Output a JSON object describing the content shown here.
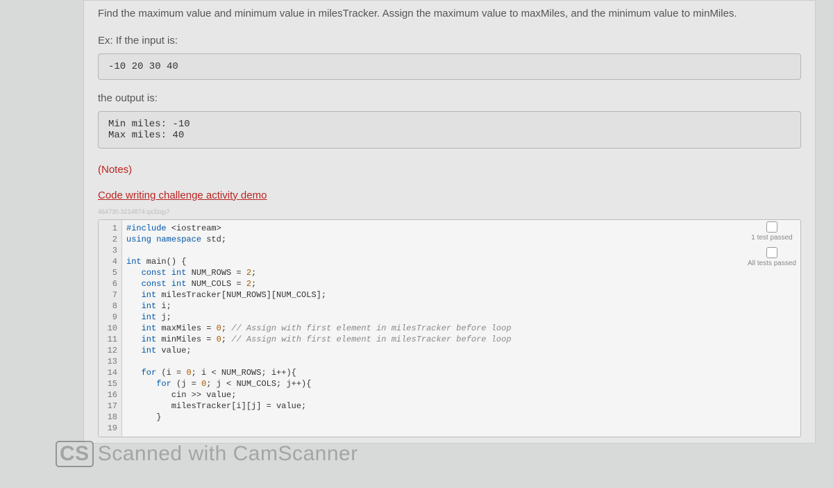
{
  "instruction": "Find the maximum value and minimum value in milesTracker. Assign the maximum value to maxMiles, and the minimum value to minMiles.",
  "exLabel": "Ex: If the input is:",
  "inputCode": "-10 20 30 40",
  "outputLabel": "the output is:",
  "outputCode": "Min miles: -10\nMax miles: 40",
  "notes": "(Notes)",
  "demoLink": "Code writing challenge activity demo",
  "smallId": "464730.3214874.qx3zqy7",
  "gutter": [
    "1",
    "2",
    "3",
    "4",
    "5",
    "6",
    "7",
    "8",
    "9",
    "10",
    "11",
    "12",
    "13",
    "14",
    "15",
    "16",
    "17",
    "18",
    "19"
  ],
  "code": {
    "l1a": "#include",
    "l1b": " <iostream>",
    "l2a": "using",
    "l2b": " namespace",
    "l2c": " std;",
    "l4a": "int",
    "l4b": " main() {",
    "l5a": "   const",
    "l5b": " int",
    "l5c": " NUM_ROWS = ",
    "l5d": "2",
    "l5e": ";",
    "l6a": "   const",
    "l6b": " int",
    "l6c": " NUM_COLS = ",
    "l6d": "2",
    "l6e": ";",
    "l7a": "   int",
    "l7b": " milesTracker[NUM_ROWS][NUM_COLS];",
    "l8a": "   int",
    "l8b": " i;",
    "l9a": "   int",
    "l9b": " j;",
    "l10a": "   int",
    "l10b": " maxMiles = ",
    "l10c": "0",
    "l10d": "; ",
    "l10e": "// Assign with first element in milesTracker before loop",
    "l11a": "   int",
    "l11b": " minMiles = ",
    "l11c": "0",
    "l11d": "; ",
    "l11e": "// Assign with first element in milesTracker before loop",
    "l12a": "   int",
    "l12b": " value;",
    "l14a": "   for",
    "l14b": " (i = ",
    "l14c": "0",
    "l14d": "; i < NUM_ROWS; i++){",
    "l15a": "      for",
    "l15b": " (j = ",
    "l15c": "0",
    "l15d": "; j < NUM_COLS; j++){",
    "l16": "         cin >> value;",
    "l17": "         milesTracker[i][j] = value;",
    "l18": "      }"
  },
  "status": {
    "oneTest": "1 test\npassed",
    "allTests": "All tests\npassed"
  },
  "watermark": {
    "badge": "CS",
    "text": "Scanned with CamScanner"
  }
}
